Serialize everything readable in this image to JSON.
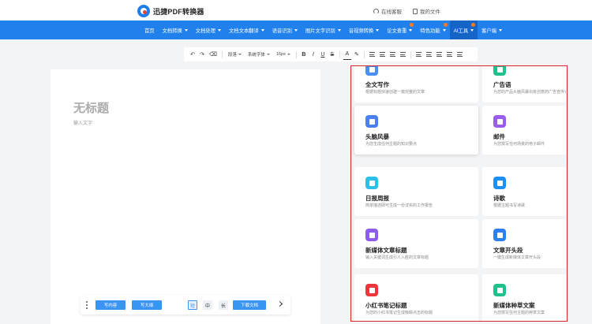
{
  "header": {
    "logo_text": "迅捷PDF转换器",
    "links": [
      {
        "label": "在线客服",
        "icon": "headset-icon"
      },
      {
        "label": "我的文件",
        "icon": "file-icon"
      }
    ]
  },
  "nav": {
    "items": [
      {
        "label": "首页",
        "dropdown": false
      },
      {
        "label": "文档转换",
        "dropdown": true
      },
      {
        "label": "文档处理",
        "dropdown": true
      },
      {
        "label": "文档文本翻译",
        "dropdown": true
      },
      {
        "label": "语音识别",
        "dropdown": true
      },
      {
        "label": "图片文字识别",
        "dropdown": true
      },
      {
        "label": "音视频转换",
        "dropdown": true
      },
      {
        "label": "论文查重",
        "dropdown": true
      },
      {
        "label": "特色功能",
        "dropdown": true
      },
      {
        "label": "AI工具",
        "dropdown": true
      },
      {
        "label": "客户端",
        "dropdown": true
      }
    ],
    "active": "AI工具",
    "accent": "#2181ec"
  },
  "toolbar": {
    "undo": "↶",
    "redo": "↷",
    "eraser": "⌫",
    "paragraph": "段落",
    "font_family": "系统字体",
    "font_size": "16px",
    "bold": "B",
    "italic": "I",
    "underline": "U",
    "strike": "S",
    "font_color": "A",
    "highlight": "✎"
  },
  "document": {
    "title": "无标题",
    "placeholder": "输入文字"
  },
  "bottom_bar": {
    "write_content": "写内容",
    "write_outline": "写大纲",
    "length_short": "短",
    "length_medium": "中",
    "length_long": "长",
    "download": "下载文档",
    "selected_length": "短"
  },
  "ai_tools": [
    {
      "title": "全文写作",
      "desc": "根据标题快速创建一篇完整的文章",
      "color": "#4a8ff5"
    },
    {
      "title": "广告语",
      "desc": "为您的产品头脑风暴出有创意的广告宣传语",
      "color": "#22c08a"
    },
    {
      "title": "头脑风暴",
      "desc": "为您生成任何主题的知识要点",
      "color": "#4a7ff5"
    },
    {
      "title": "邮件",
      "desc": "为您撰写任何场景的电子邮件",
      "color": "#9b5cf0"
    },
    {
      "title": "日报周报",
      "desc": "简单描述即可生成一份详实的工作报告",
      "color": "#2cc0e8"
    },
    {
      "title": "诗歌",
      "desc": "根据主题书写诗歌",
      "color": "#1e8ff5"
    },
    {
      "title": "新媒体文章标题",
      "desc": "输入关键词生成引人入胜的文章标题",
      "color": "#8f5cf0"
    },
    {
      "title": "文章开头段",
      "desc": "一键生成新媒体文章开头段",
      "color": "#2d7ff5"
    },
    {
      "title": "小红书笔记标题",
      "desc": "为您的小红书笔记生成吸睛点击的标题",
      "color": "#f0363c"
    },
    {
      "title": "新媒体种草文案",
      "desc": "为您撰写任何主题的种草文案",
      "color": "#22c08a"
    }
  ]
}
